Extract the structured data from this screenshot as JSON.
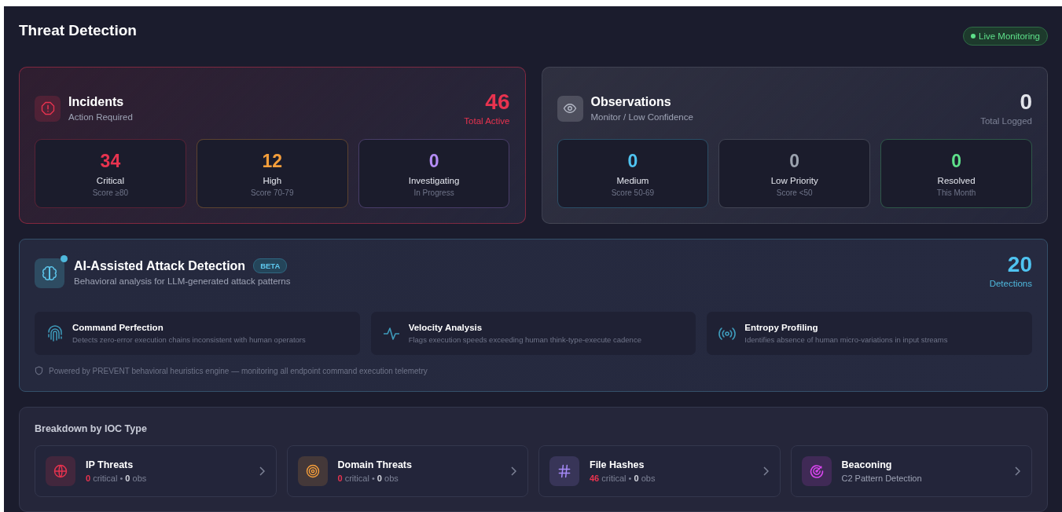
{
  "header": {
    "title": "Threat Detection",
    "status_badge": {
      "label": "Live Monitoring",
      "on": true
    }
  },
  "summary_panels": [
    {
      "kind": "incidents",
      "title": "Incidents",
      "subtitle": "Action Required",
      "total": "46",
      "total_label": "Total Active",
      "color": "#e8334f",
      "stats": [
        {
          "value": "34",
          "label": "Critical",
          "sub": "Score ≥80",
          "color": "#e8334f"
        },
        {
          "value": "12",
          "label": "High",
          "sub": "Score 70-79",
          "color": "#f59e3b"
        },
        {
          "value": "0",
          "label": "Investigating",
          "sub": "In Progress",
          "color": "#b48cf5"
        }
      ]
    },
    {
      "kind": "observations",
      "title": "Observations",
      "subtitle": "Monitor / Low Confidence",
      "total": "0",
      "total_label": "Total Logged",
      "color": "#e2e4ea",
      "stats": [
        {
          "value": "0",
          "label": "Medium",
          "sub": "Score 50-69",
          "color": "#4fc3f0"
        },
        {
          "value": "0",
          "label": "Low Priority",
          "sub": "Score <50",
          "color": "#9ca3af"
        },
        {
          "value": "0",
          "label": "Resolved",
          "sub": "This Month",
          "color": "#5ee08a"
        }
      ]
    }
  ],
  "ai_panel": {
    "title": "AI-Assisted Attack Detection",
    "badge": "BETA",
    "subtitle": "Behavioral analysis for LLM-generated attack patterns",
    "total": "20",
    "total_label": "Detections",
    "features": [
      {
        "kind": "fingerprint",
        "title": "Command Perfection",
        "description": "Detects zero-error execution chains inconsistent with human operators"
      },
      {
        "kind": "pulse",
        "title": "Velocity Analysis",
        "description": "Flags execution speeds exceeding human think-type-execute cadence"
      },
      {
        "kind": "signal",
        "title": "Entropy Profiling",
        "description": "Identifies absence of human micro-variations in input streams"
      }
    ],
    "footnote": "Powered by PREVENT behavioral heuristics engine — monitoring all endpoint command execution telemetry"
  },
  "breakdown": {
    "title": "Breakdown by IOC Type",
    "items": [
      {
        "kind": "counts",
        "color": "#e8334f",
        "name": "IP Threats",
        "critical": "0",
        "critical_label": "critical",
        "separator": "•",
        "obs": "0",
        "obs_label": "obs"
      },
      {
        "kind": "counts",
        "color": "#f59e3b",
        "name": "Domain Threats",
        "critical": "0",
        "critical_label": "critical",
        "separator": "•",
        "obs": "0",
        "obs_label": "obs"
      },
      {
        "kind": "counts",
        "color": "#a78bfa",
        "name": "File Hashes",
        "critical": "46",
        "critical_label": "critical",
        "separator": "•",
        "obs": "0",
        "obs_label": "obs"
      },
      {
        "kind": "text",
        "color": "#d946ef",
        "name": "Beaconing",
        "description": "C2 Pattern Detection"
      }
    ]
  }
}
